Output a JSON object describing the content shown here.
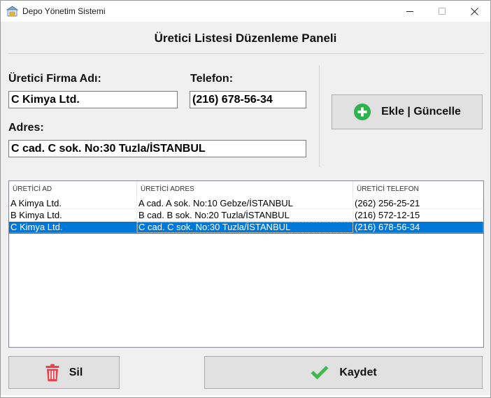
{
  "window": {
    "title": "Depo Yönetim Sistemi",
    "icon": "warehouse-icon",
    "controls": [
      "minimize-icon",
      "maximize-icon",
      "close-icon"
    ]
  },
  "panel": {
    "heading": "Üretici Listesi Düzenleme Paneli"
  },
  "form": {
    "firma_label": "Üretici Firma Adı:",
    "firma_value": "C Kimya Ltd.",
    "telefon_label": "Telefon:",
    "telefon_value": "(216) 678-56-34",
    "adres_label": "Adres:",
    "adres_value": "C cad. C sok. No:30 Tuzla/İSTANBUL"
  },
  "buttons": {
    "ekle_label": "Ekle | Güncelle",
    "ekle_icon": "plus-circle-icon",
    "sil_label": "Sil",
    "sil_icon": "trash-icon",
    "kaydet_label": "Kaydet",
    "kaydet_icon": "checkmark-icon"
  },
  "table": {
    "columns": [
      "ÜRETİCİ AD",
      "ÜRETİCİ ADRES",
      "ÜRETİCİ TELEFON"
    ],
    "rows": [
      [
        "A Kimya Ltd.",
        "A cad. A sok. No:10 Gebze/İSTANBUL",
        "(262) 256-25-21"
      ],
      [
        "B Kimya Ltd.",
        "B cad. B sok. No:20 Tuzla/İSTANBUL",
        "(216) 572-12-15"
      ],
      [
        "C Kimya Ltd.",
        "C cad. C sok. No:30 Tuzla/İSTANBUL",
        "(216) 678-56-34"
      ]
    ],
    "selected_row": 2
  },
  "colors": {
    "selection": "#0078d7",
    "plus_green": "#2eb24f",
    "trash_red": "#e8424f",
    "check_green": "#3fb950"
  }
}
